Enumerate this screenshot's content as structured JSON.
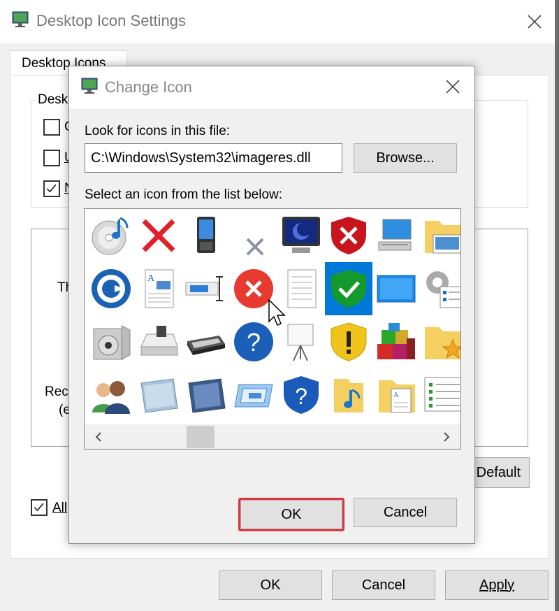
{
  "background_window": {
    "title": "Desktop Icon Settings",
    "tab_label": "Desktop Icons",
    "group_label": "Desk",
    "checkboxes": [
      {
        "label": "C",
        "checked": false
      },
      {
        "label": "U",
        "checked": false
      },
      {
        "label": "N",
        "checked": true
      }
    ],
    "preview_text_1": "Th",
    "preview_text_2": "Rec",
    "preview_text_3": "(e",
    "restore_default_label": "Default",
    "allow_themes_label": "All",
    "allow_themes_checked": true,
    "ok_label": "OK",
    "cancel_label": "Cancel",
    "apply_label": "Apply"
  },
  "dialog": {
    "title": "Change Icon",
    "look_for_label": "Look for icons in this file:",
    "path_value": "C:\\Windows\\System32\\imageres.dll",
    "browse_label": "Browse...",
    "select_label": "Select an icon from the list below:",
    "ok_label": "OK",
    "cancel_label": "Cancel"
  },
  "icons": [
    {
      "name": "disc-music-icon"
    },
    {
      "name": "red-x-icon"
    },
    {
      "name": "phone-icon"
    },
    {
      "name": "small-gray-x-icon"
    },
    {
      "name": "monitor-screensaver-icon"
    },
    {
      "name": "red-shield-x-icon"
    },
    {
      "name": "computer-icon"
    },
    {
      "name": "folder-pictures-icon"
    },
    {
      "name": "backup-clock-icon"
    },
    {
      "name": "document-picture-icon"
    },
    {
      "name": "rename-field-icon"
    },
    {
      "name": "error-circle-icon"
    },
    {
      "name": "blank-document-icon"
    },
    {
      "name": "green-shield-check-icon",
      "selected": true
    },
    {
      "name": "desktop-blue-icon"
    },
    {
      "name": "gear-checklist-icon"
    },
    {
      "name": "media-player-icon"
    },
    {
      "name": "drive-icon"
    },
    {
      "name": "scanner-icon"
    },
    {
      "name": "help-circle-icon"
    },
    {
      "name": "projector-screen-icon"
    },
    {
      "name": "yellow-shield-warning-icon"
    },
    {
      "name": "blocks-programs-icon"
    },
    {
      "name": "folder-star-icon"
    },
    {
      "name": "users-icon"
    },
    {
      "name": "device-panel-icon"
    },
    {
      "name": "device-panel-dark-icon"
    },
    {
      "name": "video-card-icon"
    },
    {
      "name": "blue-shield-help-icon"
    },
    {
      "name": "music-folder-icon"
    },
    {
      "name": "folder-documents-icon"
    },
    {
      "name": "list-window-icon"
    }
  ],
  "colors": {
    "selection": "#0078d7",
    "highlight_border": "#d9383f"
  }
}
